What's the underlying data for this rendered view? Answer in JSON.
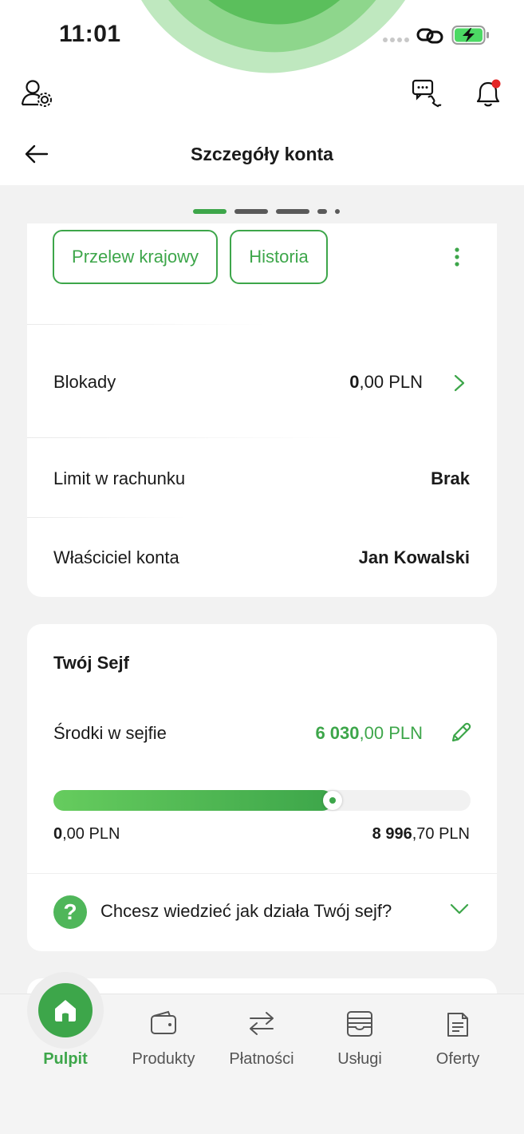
{
  "status": {
    "time": "11:01"
  },
  "header": {
    "title": "Szczegóły konta"
  },
  "actions": {
    "transfer_label": "Przelew krajowy",
    "history_label": "Historia"
  },
  "details": {
    "blokady": {
      "label": "Blokady",
      "value_int": "0",
      "value_frac": ",00 PLN"
    },
    "limit": {
      "label": "Limit w rachunku",
      "value": "Brak"
    },
    "owner": {
      "label": "Właściciel konta",
      "value": "Jan Kowalski"
    }
  },
  "sejf": {
    "title": "Twój Sejf",
    "funds_label": "Środki w sejfie",
    "funds_int": "6 030",
    "funds_frac": ",00 PLN",
    "progress_fraction": 0.67,
    "min_int": "0",
    "min_frac": ",00 PLN",
    "max_int": "8 996",
    "max_frac": ",70 PLN",
    "faq_icon": "?",
    "faq_question": "Chcesz wiedzieć jak działa Twój sejf?"
  },
  "nav": {
    "items": [
      {
        "label": "Pulpit",
        "icon": "home-icon",
        "active": true
      },
      {
        "label": "Produkty",
        "icon": "wallet-icon"
      },
      {
        "label": "Płatności",
        "icon": "transfer-arrows-icon"
      },
      {
        "label": "Usługi",
        "icon": "services-icon"
      },
      {
        "label": "Oferty",
        "icon": "offers-icon"
      }
    ]
  },
  "colors": {
    "accent": "#3da64a",
    "notification_dot": "#e32626"
  }
}
